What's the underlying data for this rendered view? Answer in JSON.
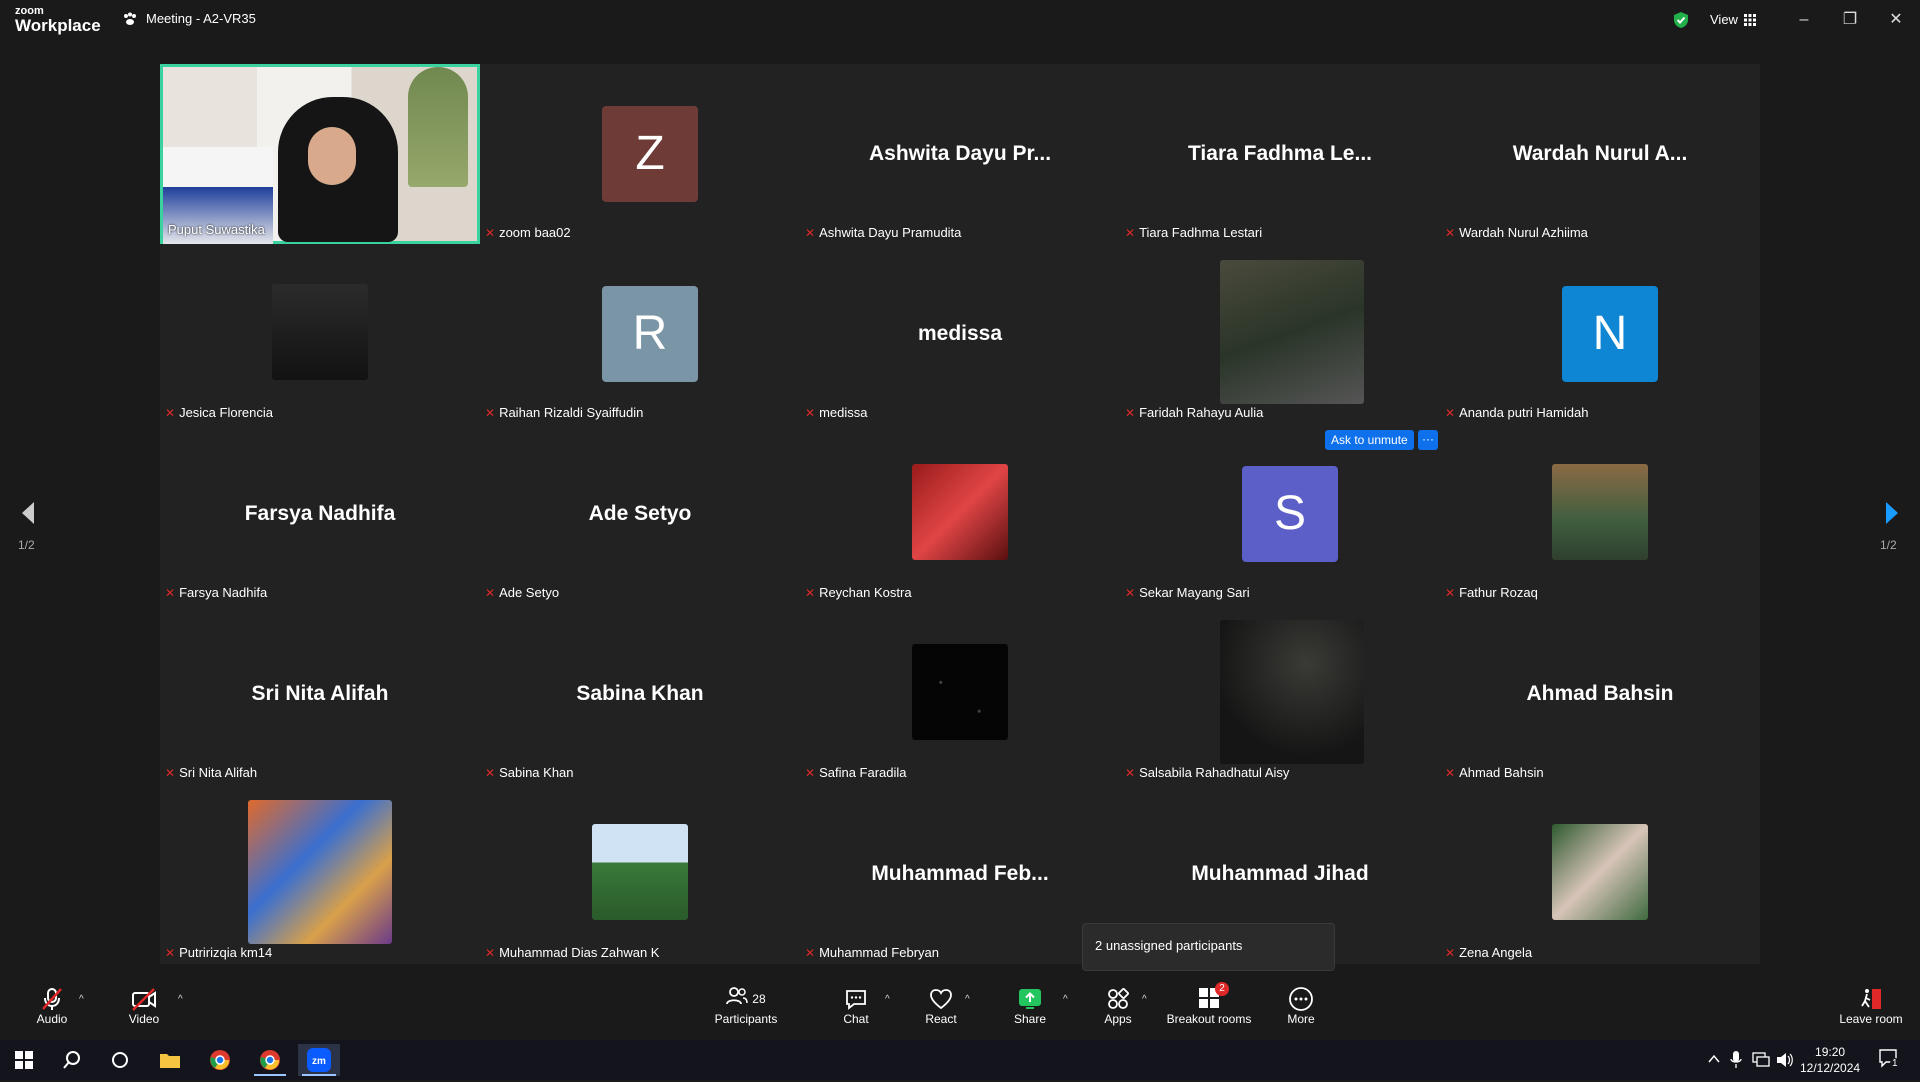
{
  "titlebar": {
    "logo_line1": "zoom",
    "logo_line2": "Workplace",
    "meeting_title": "Meeting - A2-VR35",
    "view_label": "View"
  },
  "nav": {
    "page_left": "1/2",
    "page_right": "1/2"
  },
  "participants": [
    {
      "label": "Puput Suwastika",
      "display": "video",
      "active": true
    },
    {
      "label": "zoom baa02",
      "display": "avatar",
      "initial": "Z",
      "color": "#6e3b36"
    },
    {
      "label": "Ashwita Dayu Pramudita",
      "display": "name",
      "big": "Ashwita Dayu Pr..."
    },
    {
      "label": "Tiara Fadhma Lestari",
      "display": "name",
      "big": "Tiara Fadhma Le..."
    },
    {
      "label": "Wardah Nurul Azhiima",
      "display": "name",
      "big": "Wardah Nurul A..."
    },
    {
      "label": "Jesica Florencia",
      "display": "photo",
      "photo": "dark-small"
    },
    {
      "label": "Raihan Rizaldi Syaiffudin",
      "display": "avatar",
      "initial": "R",
      "color": "#7a96a6"
    },
    {
      "label": "medissa",
      "display": "name",
      "big": "medissa"
    },
    {
      "label": "Faridah Rahayu Aulia",
      "display": "photo",
      "photo": "night-street"
    },
    {
      "label": "Ananda putri Hamidah",
      "display": "avatar",
      "initial": "N",
      "color": "#0e86d4"
    },
    {
      "label": "Farsya Nadhifa",
      "display": "name",
      "big": "Farsya Nadhifa"
    },
    {
      "label": "Ade Setyo",
      "display": "name",
      "big": "Ade Setyo"
    },
    {
      "label": "Reychan Kostra",
      "display": "photo",
      "photo": "red-racing"
    },
    {
      "label": "Sekar Mayang Sari",
      "display": "avatar",
      "initial": "S",
      "color": "#5b5fc7"
    },
    {
      "label": "Fathur Rozaq",
      "display": "photo",
      "photo": "portrait-green"
    },
    {
      "label": "Sri Nita Alifah",
      "display": "name",
      "big": "Sri Nita Alifah"
    },
    {
      "label": "Sabina Khan",
      "display": "name",
      "big": "Sabina Khan"
    },
    {
      "label": "Safina Faradila",
      "display": "photo",
      "photo": "starry"
    },
    {
      "label": "Salsabila Rahadhatul Aisy",
      "display": "photo",
      "photo": "clouds"
    },
    {
      "label": "Ahmad Bahsin",
      "display": "name",
      "big": "Ahmad Bahsin"
    },
    {
      "label": "Putririzqia km14",
      "display": "photo",
      "photo": "flowers"
    },
    {
      "label": "Muhammad Dias Zahwan K",
      "display": "photo",
      "photo": "field"
    },
    {
      "label": "Muhammad Febryan",
      "display": "name",
      "big": "Muhammad  Feb..."
    },
    {
      "label": "",
      "display": "name",
      "big": "Muhammad Jihad"
    },
    {
      "label": "Zena Angela",
      "display": "photo",
      "photo": "hijab-leaves"
    }
  ],
  "ask_to_unmute": "Ask to unmute",
  "ask_more": "···",
  "tooltip": "2 unassigned participants",
  "toolbar": {
    "audio": "Audio",
    "video": "Video",
    "participants": "Participants",
    "participants_count": "28",
    "chat": "Chat",
    "react": "React",
    "share": "Share",
    "apps": "Apps",
    "breakout": "Breakout rooms",
    "breakout_badge": "2",
    "more": "More",
    "leave": "Leave room"
  },
  "taskbar": {
    "time": "19:20",
    "date": "12/12/2024",
    "notif": "1"
  }
}
